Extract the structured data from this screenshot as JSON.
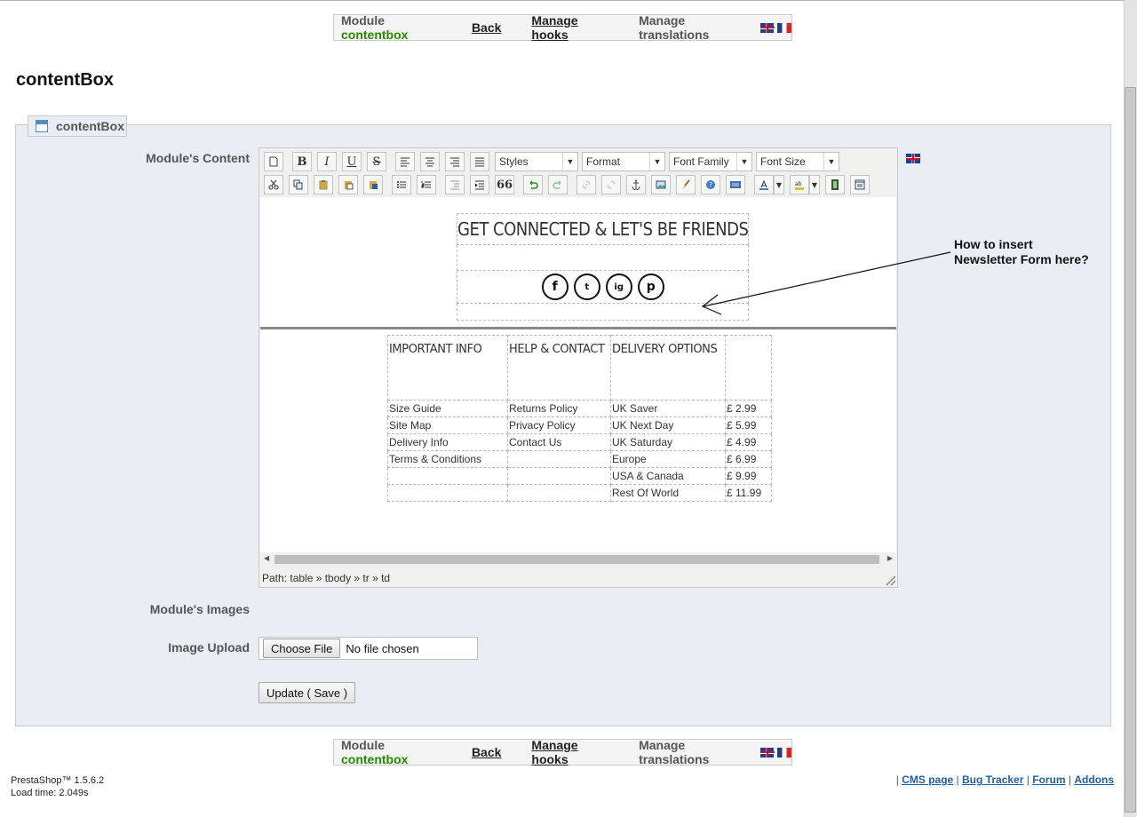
{
  "module_bar": {
    "module_prefix": "Module",
    "module_name": "contentbox",
    "back": "Back",
    "manage_hooks": "Manage hooks",
    "manage_translations": "Manage translations"
  },
  "page_title": "contentBox",
  "panel_legend": "contentBox",
  "labels": {
    "content": "Module's Content",
    "images": "Module's Images",
    "upload": "Image Upload"
  },
  "toolbar": {
    "bold": "B",
    "italic": "I",
    "underline": "U",
    "strike": "S",
    "quote": "66",
    "styles": "Styles",
    "format": "Format",
    "font_family": "Font Family",
    "font_size": "Font Size"
  },
  "editor": {
    "heading": "GET CONNECTED & LET'S BE FRIENDS",
    "social": [
      "f",
      "t",
      "ig",
      "p"
    ],
    "table": {
      "headers": [
        "IMPORTANT INFO",
        "HELP & CONTACT",
        "DELIVERY OPTIONS",
        ""
      ],
      "rows": [
        [
          "Size Guide",
          "Returns Policy",
          "UK Saver",
          "£ 2.99"
        ],
        [
          "Site Map",
          "Privacy Policy",
          "UK Next Day",
          "£ 5.99"
        ],
        [
          "Delivery Info",
          "Contact Us",
          "UK Saturday",
          "£ 4.99"
        ],
        [
          "Terms & Conditions",
          "",
          "Europe",
          "£ 6.99"
        ],
        [
          "",
          "",
          "USA & Canada",
          "£ 9.99"
        ],
        [
          "",
          "",
          "Rest Of World",
          "£ 11.99"
        ]
      ]
    },
    "path": "Path: table » tbody » tr » td"
  },
  "annotation": {
    "line1": "How to insert",
    "line2": "Newsletter Form here?"
  },
  "upload": {
    "choose": "Choose File",
    "no_file": "No file chosen"
  },
  "update_button": "Update ( Save )",
  "footer": {
    "version": "PrestaShop™ 1.5.6.2",
    "load_time": "Load time: 2.049s",
    "links": [
      "CMS page",
      "Bug Tracker",
      "Forum",
      "Addons"
    ]
  },
  "colors": {
    "module_name": "#268b00",
    "panel_bg": "#ebedf4",
    "link": "#1f5fa8"
  }
}
